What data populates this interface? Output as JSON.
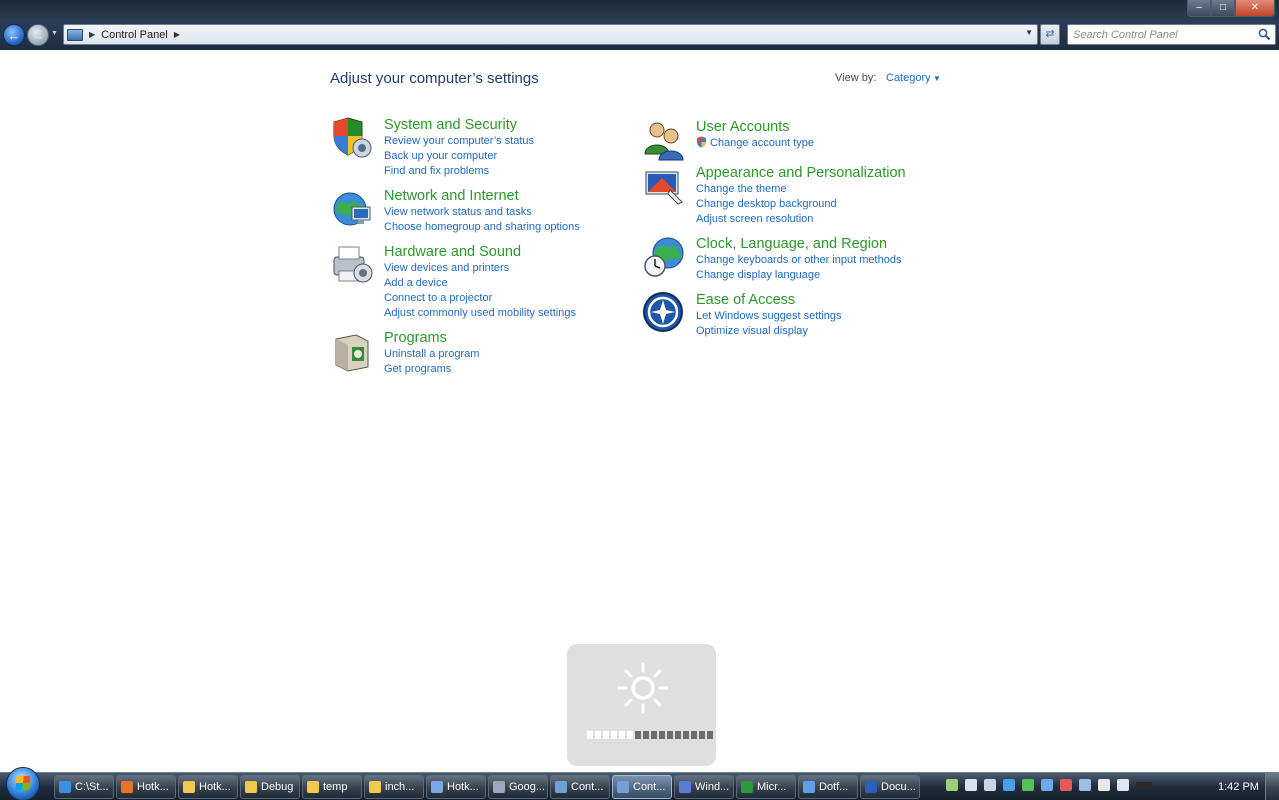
{
  "window": {
    "minimize": "‒",
    "maximize": "□",
    "close": "✕"
  },
  "nav": {
    "breadcrumb": "Control Panel",
    "search_placeholder": "Search Control Panel"
  },
  "main": {
    "title": "Adjust your computer’s settings",
    "view_by_label": "View by:",
    "view_by_value": "Category"
  },
  "categories_left": [
    {
      "title": "System and Security",
      "links": [
        "Review your computer’s status",
        "Back up your computer",
        "Find and fix problems"
      ],
      "icon": "shield-icon"
    },
    {
      "title": "Network and Internet",
      "links": [
        "View network status and tasks",
        "Choose homegroup and sharing options"
      ],
      "icon": "network-globe-icon"
    },
    {
      "title": "Hardware and Sound",
      "links": [
        "View devices and printers",
        "Add a device",
        "Connect to a projector",
        "Adjust commonly used mobility settings"
      ],
      "icon": "printer-icon"
    },
    {
      "title": "Programs",
      "links": [
        "Uninstall a program",
        "Get programs"
      ],
      "icon": "programs-box-icon"
    }
  ],
  "categories_right": [
    {
      "title": "User Accounts",
      "links": [
        "Change account type"
      ],
      "icon": "users-icon"
    },
    {
      "title": "Appearance and Personalization",
      "links": [
        "Change the theme",
        "Change desktop background",
        "Adjust screen resolution"
      ],
      "icon": "display-paint-icon"
    },
    {
      "title": "Clock, Language, and Region",
      "links": [
        "Change keyboards or other input methods",
        "Change display language"
      ],
      "icon": "clock-globe-icon"
    },
    {
      "title": "Ease of Access",
      "links": [
        "Let Windows suggest settings",
        "Optimize visual display"
      ],
      "icon": "ease-of-access-icon"
    }
  ],
  "osd": {
    "type": "brightness",
    "icon": "sun-icon",
    "level_fraction": 0.375,
    "segments_total": 16,
    "segments_on": 6
  },
  "taskbar": {
    "items": [
      {
        "label": "C:\\St...",
        "icon": "ie-icon",
        "color": "#3a8ee6"
      },
      {
        "label": "Hotk...",
        "icon": "firefox-icon",
        "color": "#e8742a"
      },
      {
        "label": "Hotk...",
        "icon": "folder-icon",
        "color": "#f2c94c"
      },
      {
        "label": "Debug",
        "icon": "folder-icon",
        "color": "#f2c94c"
      },
      {
        "label": "temp",
        "icon": "folder-icon",
        "color": "#f2c94c"
      },
      {
        "label": "inch...",
        "icon": "folder-icon",
        "color": "#f2c94c"
      },
      {
        "label": "Hotk...",
        "icon": "app-icon",
        "color": "#7aa8e0"
      },
      {
        "label": "Goog...",
        "icon": "chrome-icon",
        "color": "#9aa9bd"
      },
      {
        "label": "Cont...",
        "icon": "control-panel-icon",
        "color": "#6fa0d8"
      },
      {
        "label": "Cont...",
        "icon": "control-panel-icon",
        "color": "#6fa0d8"
      },
      {
        "label": "Wind...",
        "icon": "window-icon",
        "color": "#5a7bd6"
      },
      {
        "label": "Micr...",
        "icon": "excel-icon",
        "color": "#2e9a3a"
      },
      {
        "label": "Dotf...",
        "icon": "diamond-icon",
        "color": "#5f9ee8"
      },
      {
        "label": "Docu...",
        "icon": "word-icon",
        "color": "#2b5fb8"
      }
    ],
    "active_index": 9,
    "tray_icons": [
      "notes-icon",
      "chevron-up-icon",
      "doc-icon",
      "sync-icon",
      "chat-icon",
      "bluetooth-icon",
      "shield-tray-icon",
      "network-tray-icon",
      "power-icon",
      "volume-icon",
      "battery-icon"
    ],
    "clock": "1:42 PM"
  }
}
